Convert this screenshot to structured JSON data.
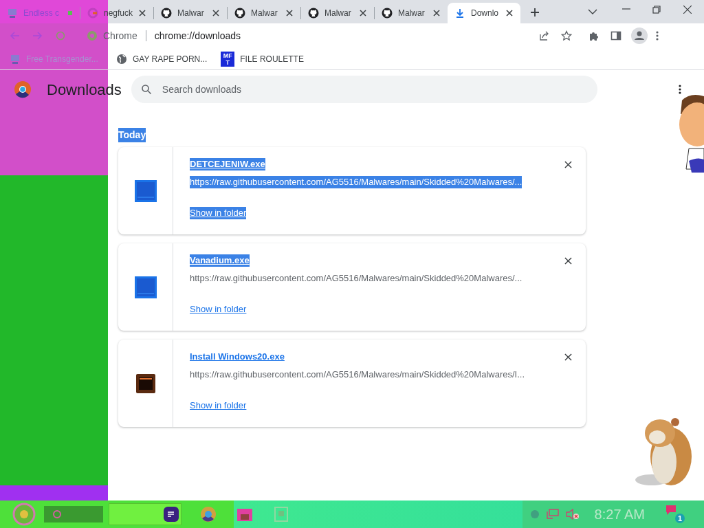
{
  "tabs": [
    {
      "title": "Endless c",
      "kind": "computer",
      "selected": false
    },
    {
      "title": "negfuck",
      "kind": "g",
      "selected": false
    },
    {
      "title": "Malwar",
      "kind": "github",
      "selected": false
    },
    {
      "title": "Malwar",
      "kind": "github",
      "selected": false
    },
    {
      "title": "Malwar",
      "kind": "github",
      "selected": false
    },
    {
      "title": "Malwar",
      "kind": "github",
      "selected": false
    },
    {
      "title": "Downlo",
      "kind": "download",
      "selected": true
    }
  ],
  "omnibox": {
    "site": "Chrome",
    "url": "chrome://downloads"
  },
  "bookmarks": [
    {
      "label": "Free Transgender...",
      "kind": "computer"
    },
    {
      "label": "GAY RAPE PORN...",
      "kind": "globe"
    },
    {
      "label": "FILE ROULETTE",
      "kind": "mft",
      "icon_text": [
        "MF",
        "T"
      ]
    }
  ],
  "page": {
    "title": "Downloads",
    "search": {
      "placeholder": "Search downloads"
    },
    "section": {
      "label": "Today",
      "highlighted": true
    },
    "items": [
      {
        "kind": "app",
        "name": {
          "text": "DETCEJENIW.exe",
          "highlighted": true
        },
        "url": {
          "text": "https://raw.githubusercontent.com/AG5516/Malwares/main/Skidded%20Malwares/...",
          "highlighted": true
        },
        "link": {
          "text": "Show in folder",
          "highlighted": true
        }
      },
      {
        "kind": "app",
        "name": {
          "text": "Vanadium.exe",
          "highlighted": true
        },
        "url": {
          "text": "https://raw.githubusercontent.com/AG5516/Malwares/main/Skidded%20Malwares/...",
          "highlighted": false
        },
        "link": {
          "text": "Show in folder",
          "highlighted": false
        }
      },
      {
        "kind": "window",
        "name": {
          "text": "Install Windows20.exe",
          "highlighted": false
        },
        "url": {
          "text": "https://raw.githubusercontent.com/AG5516/Malwares/main/Skidded%20Malwares/I...",
          "highlighted": false
        },
        "link": {
          "text": "Show in folder",
          "highlighted": false
        }
      }
    ]
  },
  "taskbar": {
    "clock": "8:27 AM",
    "notifications": "1",
    "volume_muted": true
  }
}
